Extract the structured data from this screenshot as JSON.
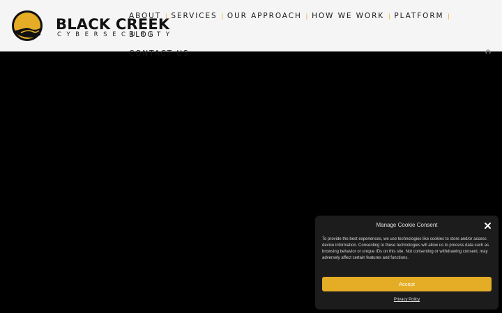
{
  "brand": {
    "name": "BLACK CREEK",
    "tagline": "CYBERSECURITY",
    "accent_color": "#e5ad26"
  },
  "nav": {
    "items": [
      {
        "label": "ABOUT"
      },
      {
        "label": "SERVICES"
      },
      {
        "label": "OUR APPROACH"
      },
      {
        "label": "HOW WE WORK"
      },
      {
        "label": "PLATFORM"
      },
      {
        "label": "BLOG"
      },
      {
        "label": "CONTACT US"
      }
    ],
    "separator": "|"
  },
  "icons": {
    "logo": "creek-road-logo-icon",
    "search": "search-icon",
    "close": "close-icon"
  },
  "cookie": {
    "title": "Manage Cookie Consent",
    "body": "To provide the best experiences, we use technologies like cookies to store and/or access device information. Consenting to these technologies will allow us to process data such as browsing behavior or unique IDs on this site. Not consenting or withdrawing consent, may adversely affect certain features and functions.",
    "accept_label": "Accept",
    "policy_label": "Privacy Policy"
  }
}
